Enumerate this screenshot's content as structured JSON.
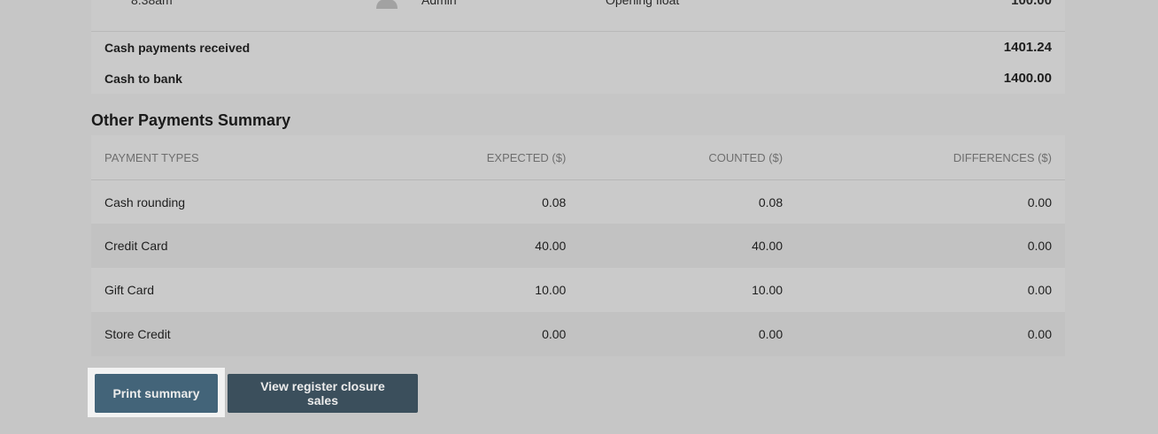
{
  "previous_row": {
    "time": "8:38am",
    "user": "Admin",
    "note": "Opening float",
    "amount": "100.00"
  },
  "cash_summary": {
    "received_label": "Cash payments received",
    "received_value": "1401.24",
    "bank_label": "Cash to bank",
    "bank_value": "1400.00"
  },
  "other_payments": {
    "title": "Other Payments Summary",
    "columns": [
      "PAYMENT TYPES",
      "EXPECTED ($)",
      "COUNTED ($)",
      "DIFFERENCES ($)"
    ],
    "rows": [
      {
        "type": "Cash rounding",
        "expected": "0.08",
        "counted": "0.08",
        "difference": "0.00"
      },
      {
        "type": "Credit Card",
        "expected": "40.00",
        "counted": "40.00",
        "difference": "0.00"
      },
      {
        "type": "Gift Card",
        "expected": "10.00",
        "counted": "10.00",
        "difference": "0.00"
      },
      {
        "type": "Store Credit",
        "expected": "0.00",
        "counted": "0.00",
        "difference": "0.00"
      }
    ]
  },
  "actions": {
    "print_label": "Print summary",
    "view_label": "View register closure sales"
  },
  "colors": {
    "primary_button": "#436479",
    "secondary_button": "#3b4f5c",
    "overlay_bg": "#c6c6c6"
  },
  "icons": {
    "avatar": "user-avatar-icon"
  }
}
